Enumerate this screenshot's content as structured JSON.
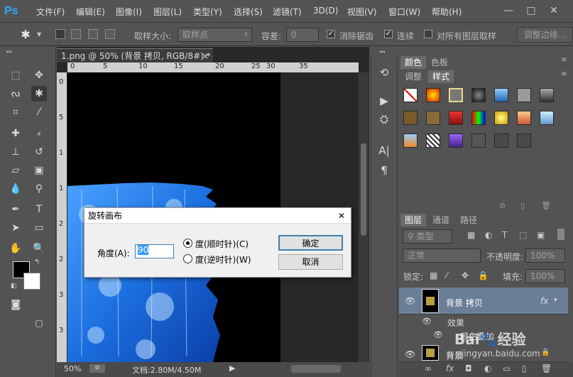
{
  "app": {
    "logo": "Ps"
  },
  "menu": [
    "文件(F)",
    "编辑(E)",
    "图像(I)",
    "图层(L)",
    "类型(Y)",
    "选择(S)",
    "滤镜(T)",
    "3D(D)",
    "视图(V)",
    "窗口(W)",
    "帮助(H)"
  ],
  "window_buttons": {
    "minimize": "—",
    "maximize": "□",
    "close": "✕"
  },
  "options": {
    "sample_size_label": "取样大小:",
    "sample_size_value": "取样点",
    "tolerance_label": "容差:",
    "tolerance_value": "0",
    "antialias_label": "消除锯齿",
    "contiguous_label": "连续",
    "all_layers_label": "对所有图层取样",
    "refine_edge_label": "调整边缘..."
  },
  "document": {
    "tab_title": "1.png @ 50% (背景 拷贝, RGB/8#) *",
    "close": "×",
    "h_ruler_ticks": [
      "0",
      "5",
      "10",
      "15",
      "20",
      "25",
      "30",
      "35"
    ],
    "v_ruler_ticks": [
      "0",
      "5",
      "1",
      "1",
      "2",
      "2",
      "3",
      "3"
    ],
    "zoom": "50%",
    "doc_info": "文档:2.80M/4.50M"
  },
  "panels": {
    "top_tabs": [
      "颜色",
      "色板"
    ],
    "mid_tabs": [
      "调整",
      "样式"
    ],
    "layers_tabs": [
      "图层",
      "通道",
      "路径"
    ],
    "filter_kind": "类型",
    "blend_mode": "正常",
    "opacity_label": "不透明度:",
    "opacity_value": "100%",
    "lock_label": "锁定:",
    "fill_label": "填充:",
    "fill_value": "100%",
    "layers": [
      {
        "name": "背景 拷贝",
        "fx": "fx"
      },
      {
        "name": "背景"
      }
    ],
    "effects_label": "效果",
    "effect_item": "颜色叠加"
  },
  "dialog": {
    "title": "旋转画布",
    "angle_label": "角度(A):",
    "angle_value": "90",
    "cw_label": "度(顺时针)(C)",
    "ccw_label": "度(逆时针)(W)",
    "ok_label": "确定",
    "cancel_label": "取消",
    "close": "✕"
  },
  "watermark": "Bai度经验 jingyan.baidu.com",
  "colors": {
    "accent": "#31a8ff",
    "panel": "#535353",
    "dialog_bg": "#f0f0f0"
  }
}
